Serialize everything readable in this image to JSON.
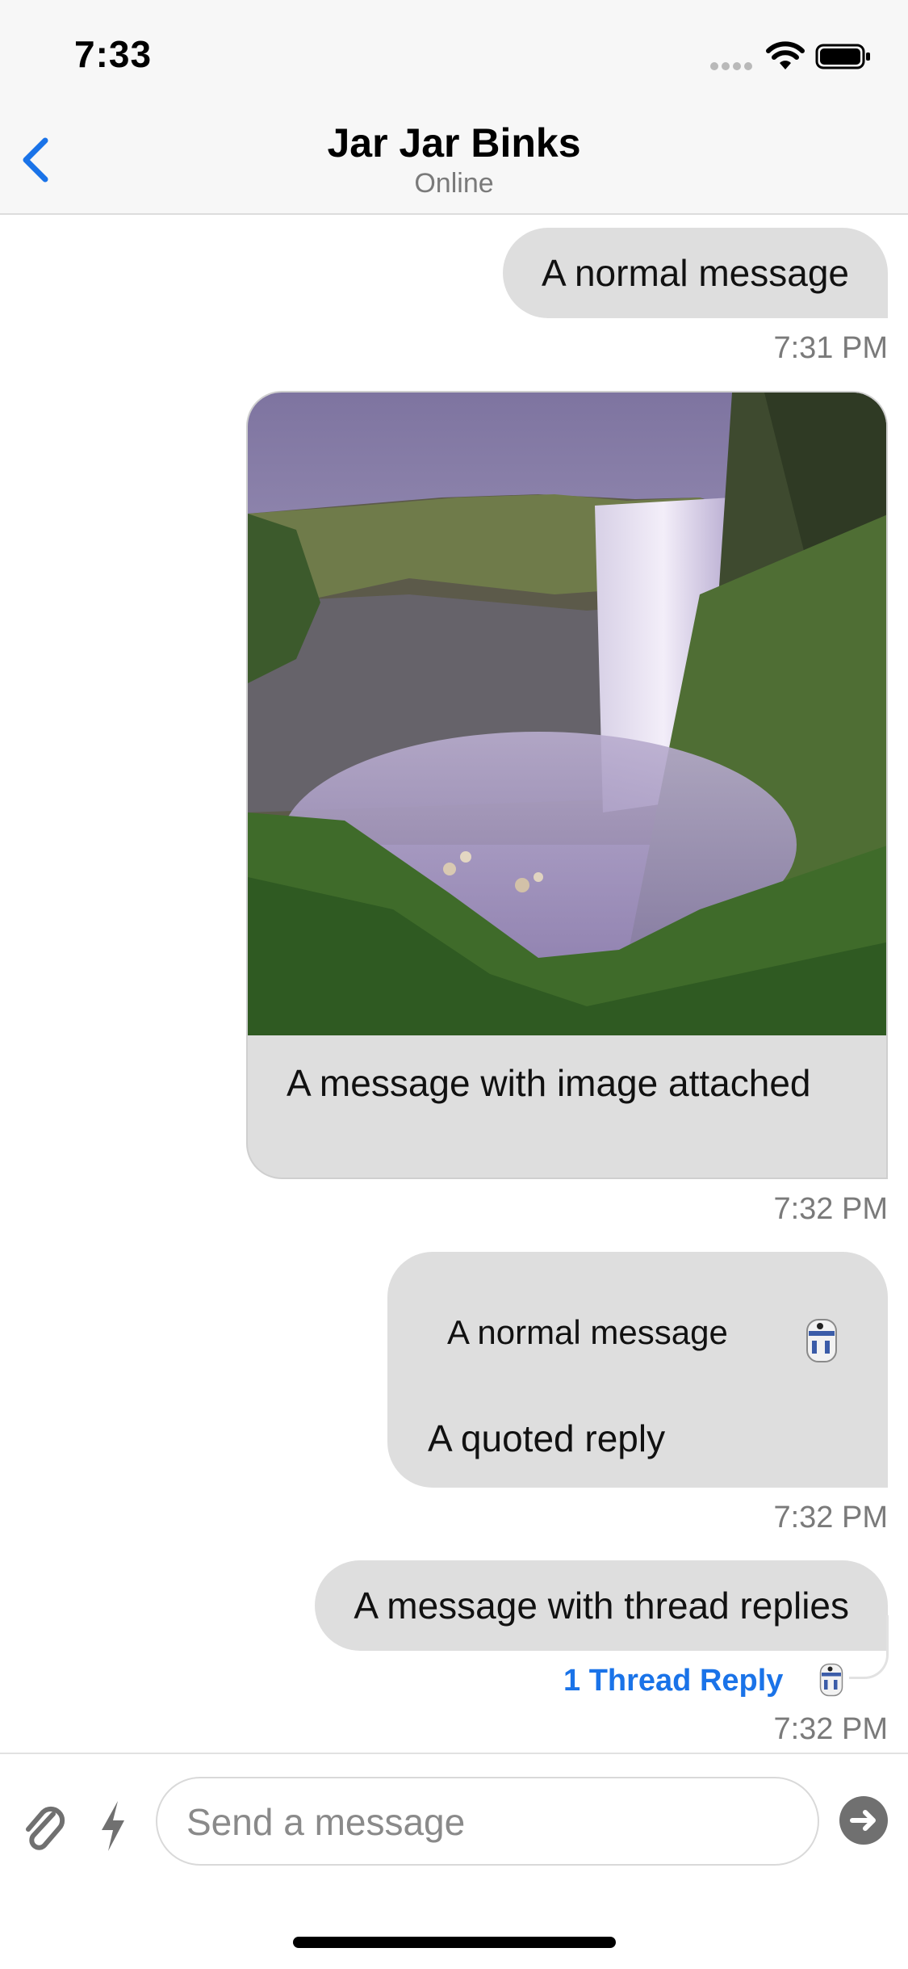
{
  "status_bar": {
    "time": "7:33"
  },
  "header": {
    "title": "Jar Jar Binks",
    "subtitle": "Online"
  },
  "messages": [
    {
      "text": "A normal message",
      "time": "7:31 PM"
    },
    {
      "text": "A message with image attached",
      "time": "7:32 PM",
      "attachment": "waterfall-photo"
    },
    {
      "quoted_text": "A normal message",
      "text": "A quoted reply",
      "time": "7:32 PM"
    },
    {
      "text": "A message with thread replies",
      "thread_label": "1 Thread Reply",
      "time": "7:32 PM"
    }
  ],
  "composer": {
    "placeholder": "Send a message",
    "value": ""
  },
  "colors": {
    "accent": "#1a73e8",
    "bubble": "#dedede",
    "header_bg": "#f7f7f7"
  },
  "icons": [
    "back-chevron-icon",
    "wifi-icon",
    "battery-icon",
    "paperclip-icon",
    "lightning-icon",
    "send-arrow-icon",
    "avatar-r2d2"
  ]
}
